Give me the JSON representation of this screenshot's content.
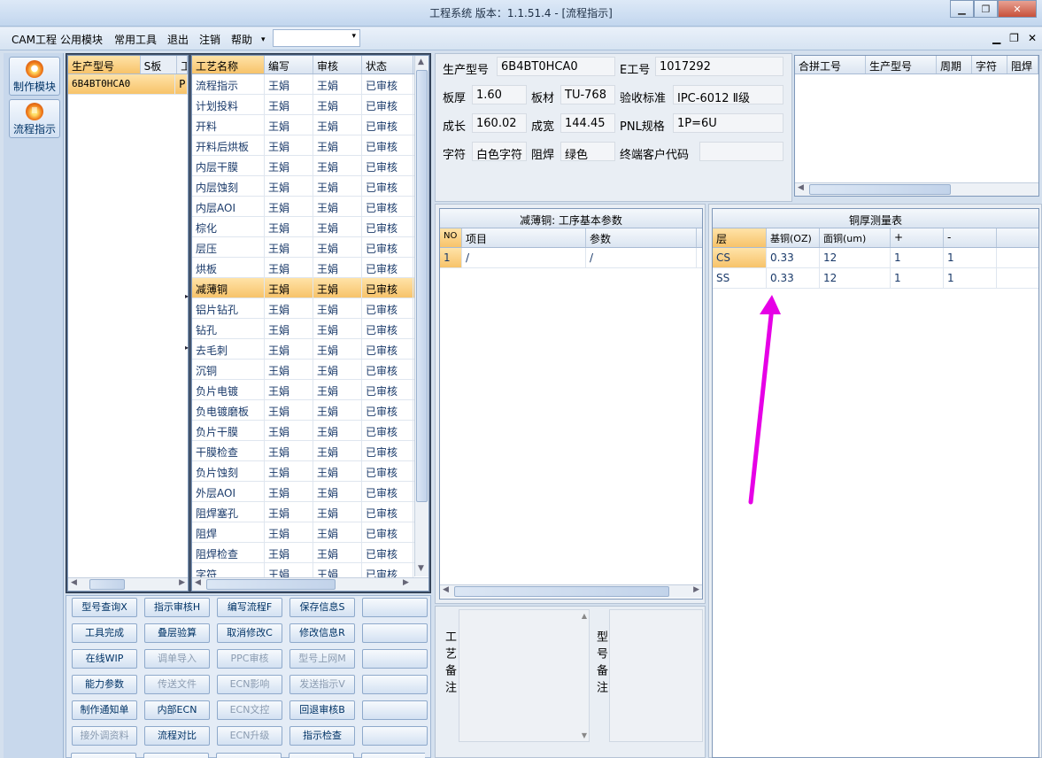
{
  "window": {
    "title": "工程系统  版本：1.1.51.4 - [流程指示]"
  },
  "menu": [
    "CAM工程",
    "公用模块",
    "常用工具",
    "退出",
    "注销",
    "帮助"
  ],
  "menu_combo_value": "",
  "sidebar": [
    {
      "label": "制作模块",
      "icon": "fire-icon"
    },
    {
      "label": "流程指示",
      "icon": "flow-icon"
    }
  ],
  "product_grid": {
    "headers": [
      "生产型号",
      "S板",
      "工"
    ],
    "rows": [
      [
        "6B4BT0HCA0",
        "P"
      ]
    ]
  },
  "process_grid": {
    "headers": [
      "工艺名称",
      "编写",
      "审核",
      "状态"
    ],
    "selected_index": 10,
    "rows": [
      [
        "流程指示",
        "王娟",
        "王娟",
        "已审核"
      ],
      [
        "计划投料",
        "王娟",
        "王娟",
        "已审核"
      ],
      [
        "开料",
        "王娟",
        "王娟",
        "已审核"
      ],
      [
        "开料后烘板",
        "王娟",
        "王娟",
        "已审核"
      ],
      [
        "内层干膜",
        "王娟",
        "王娟",
        "已审核"
      ],
      [
        "内层蚀刻",
        "王娟",
        "王娟",
        "已审核"
      ],
      [
        "内层AOI",
        "王娟",
        "王娟",
        "已审核"
      ],
      [
        "棕化",
        "王娟",
        "王娟",
        "已审核"
      ],
      [
        "层压",
        "王娟",
        "王娟",
        "已审核"
      ],
      [
        "烘板",
        "王娟",
        "王娟",
        "已审核"
      ],
      [
        "减薄铜",
        "王娟",
        "王娟",
        "已审核"
      ],
      [
        "铝片钻孔",
        "王娟",
        "王娟",
        "已审核"
      ],
      [
        "钻孔",
        "王娟",
        "王娟",
        "已审核"
      ],
      [
        "去毛刺",
        "王娟",
        "王娟",
        "已审核"
      ],
      [
        "沉铜",
        "王娟",
        "王娟",
        "已审核"
      ],
      [
        "负片电镀",
        "王娟",
        "王娟",
        "已审核"
      ],
      [
        "负电镀磨板",
        "王娟",
        "王娟",
        "已审核"
      ],
      [
        "负片干膜",
        "王娟",
        "王娟",
        "已审核"
      ],
      [
        "干膜检查",
        "王娟",
        "王娟",
        "已审核"
      ],
      [
        "负片蚀刻",
        "王娟",
        "王娟",
        "已审核"
      ],
      [
        "外层AOI",
        "王娟",
        "王娟",
        "已审核"
      ],
      [
        "阻焊塞孔",
        "王娟",
        "王娟",
        "已审核"
      ],
      [
        "阻焊",
        "王娟",
        "王娟",
        "已审核"
      ],
      [
        "阻焊检查",
        "王娟",
        "王娟",
        "已审核"
      ],
      [
        "字符",
        "王娟",
        "王娟",
        "已审核"
      ]
    ]
  },
  "buttons": [
    [
      "型号查询X",
      "指示审核H",
      "编写流程F",
      "保存信息S",
      ""
    ],
    [
      "工具完成",
      "叠层验算",
      "取消修改C",
      "修改信息R",
      ""
    ],
    [
      "在线WIP",
      "调单导入",
      "PPC审核",
      "型号上网M",
      ""
    ],
    [
      "能力参数",
      "传送文件",
      "ECN影响",
      "发送指示V",
      ""
    ],
    [
      "制作通知单",
      "内部ECN",
      "ECN文控",
      "回退审核B",
      ""
    ],
    [
      "接外调资料",
      "流程对比",
      "ECN升级",
      "指示检查",
      ""
    ]
  ],
  "buttons_disabled": [
    "调单导入",
    "PPC审核",
    "型号上网M",
    "传送文件",
    "ECN影响",
    "发送指示V",
    "ECN文控",
    "ECN升级",
    "接外调资料"
  ],
  "info": {
    "model_label": "生产型号",
    "model_value": "6B4BT0HCA0",
    "eno_label": "E工号",
    "eno_value": "1017292",
    "thickness_label": "板厚",
    "thickness_value": "1.60",
    "material_label": "板材",
    "material_value": "TU-768",
    "standard_label": "验收标准",
    "standard_value": "IPC-6012 Ⅱ级",
    "length_label": "成长",
    "length_value": "160.02",
    "width_label": "成宽",
    "width_value": "144.45",
    "pnl_label": "PNL规格",
    "pnl_value": "1P=6U",
    "char_label": "字符",
    "char_value": "白色字符",
    "solder_label": "阻焊",
    "solder_value": "绿色",
    "customer_label": "终端客户代码",
    "customer_value": ""
  },
  "merge_grid": {
    "headers": [
      "合拼工号",
      "生产型号",
      "周期",
      "字符",
      "阻焊"
    ]
  },
  "params_panel": {
    "title": "减薄铜: 工序基本参数",
    "headers": [
      "NO",
      "项目",
      "参数"
    ],
    "rows": [
      [
        "1",
        "/",
        "/"
      ]
    ]
  },
  "copper_panel": {
    "title": "铜厚测量表",
    "headers": [
      "层",
      "基铜(OZ)",
      "面铜(um)",
      "+",
      "-"
    ],
    "rows": [
      [
        "CS",
        "0.33",
        "12",
        "1",
        "1"
      ],
      [
        "SS",
        "0.33",
        "12",
        "1",
        "1"
      ]
    ]
  },
  "remarks": {
    "process_label": "工艺备注",
    "model_label": "型号备注"
  },
  "annotation_color": "#e600e6"
}
